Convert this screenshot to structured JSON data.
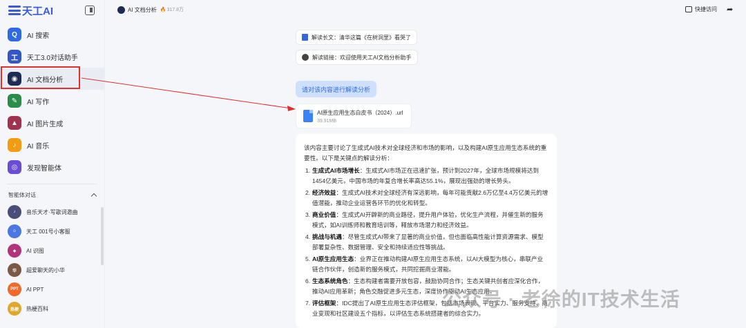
{
  "app": {
    "logo_text": "天工AI"
  },
  "sidebar": {
    "items": [
      {
        "label": "AI 搜索",
        "icon": "search-icon",
        "color": "#2f6ae3",
        "glyph": "Q"
      },
      {
        "label": "天工3.0对话助手",
        "icon": "chat-icon",
        "color": "#3457c8",
        "glyph": "工"
      },
      {
        "label": "AI 文档分析",
        "icon": "document-icon",
        "color": "#1d2b55",
        "glyph": "◉"
      },
      {
        "label": "AI 写作",
        "icon": "pen-icon",
        "color": "#2a8c4a",
        "glyph": "✎"
      },
      {
        "label": "AI 图片生成",
        "icon": "image-icon",
        "color": "#a0324f",
        "glyph": "▲"
      },
      {
        "label": "AI 音乐",
        "icon": "music-icon",
        "color": "#f39c12",
        "glyph": "♪"
      },
      {
        "label": "发现智能体",
        "icon": "discover-icon",
        "color": "#6a4cd8",
        "glyph": "◎"
      }
    ],
    "agents_section_title": "智能体对话",
    "agents": [
      {
        "label": "音乐天才·写歌词邀曲",
        "color": "#4a4f7a",
        "glyph": "♪"
      },
      {
        "label": "天工 001号小客服",
        "color": "#4a78e0",
        "glyph": "☺"
      },
      {
        "label": "AI 识图",
        "color": "#b4337a",
        "glyph": "◆"
      },
      {
        "label": "超爱聊天的小华",
        "color": "#7b5a45",
        "glyph": "华"
      },
      {
        "label": "AI PPT",
        "color": "#f06a2a",
        "glyph": "PPT"
      },
      {
        "label": "热梗百科",
        "color": "#e0a82a",
        "glyph": "热梗"
      }
    ]
  },
  "topbar": {
    "title": "AI 文档分析",
    "heat": "317.8万",
    "quick_visit": "快捷访问"
  },
  "chips": [
    {
      "label": "解读长文：清华这篇《在树洞里》看哭了"
    },
    {
      "label": "解读链接：欢迎使用天工AI文档分析助手"
    }
  ],
  "user_message": "请对该内容进行解读分析",
  "file": {
    "name": "AI原生应用生态白皮书（2024）.url",
    "size": "39.91MB"
  },
  "answer": {
    "intro": "该内容主要讨论了生成式AI技术对全球经济和市场的影响，以及构建AI原生应用生态系统的重要性。以下是关键点的解读分析：",
    "points": [
      {
        "num": "1.",
        "title": "生成式AI市场增长",
        "text": "：生成式AI市场正在迅速扩张，预计到2027年，全球市场规模将达到1454亿美元，中国市场的年复合增长率高达55.1%，展现出强劲的增长势头。"
      },
      {
        "num": "2.",
        "title": "经济效益",
        "text": "：生成式AI技术对全球经济有深远影响，每年可能贡献2.6万亿至4.4万亿美元的增值潜能，推动企业运营各环节的优化和转型。"
      },
      {
        "num": "3.",
        "title": "商业价值",
        "text": "：生成式AI开辟新的商业路径，提升用户体验，优化生产流程，并催生新的服务模式，如AI训练师和教育培训等，释放市场潜力和经济效益。"
      },
      {
        "num": "4.",
        "title": "挑战与机遇",
        "text": "：尽管生成式AI带来了显著的商业价值，但也面临高性能计算资源需求、模型部署复杂性、数据管理、安全和持续适应性等挑战。"
      },
      {
        "num": "5.",
        "title": "AI原生应用生态",
        "text": "：业界正在推动构建AI原生应用生态系统，以AI大模型为核心，串联产业链合作伙伴，创造新的服务模式，共同挖掘商业潜能。"
      },
      {
        "num": "6.",
        "title": "生态系统角色",
        "text": "：生态构建者需要开放包容，鼓励协同合作；生态关键共创者应深化合作，推动AI应用革新；角色交融促进多元生态，深度协作驱动AI生态应用。"
      },
      {
        "num": "7.",
        "title": "评估框架",
        "text": "：IDC提出了AI原生应用生态评估框架，包括市场表现、平台实力、服务支持、商业变现和社区建设五个指标，以评估生态系统搭建者的综合实力。"
      }
    ]
  },
  "watermark": "公众号 · 老徐的IT技术生活",
  "colors": {
    "accent": "#2f6ae3",
    "highlight": "#e0302e"
  }
}
